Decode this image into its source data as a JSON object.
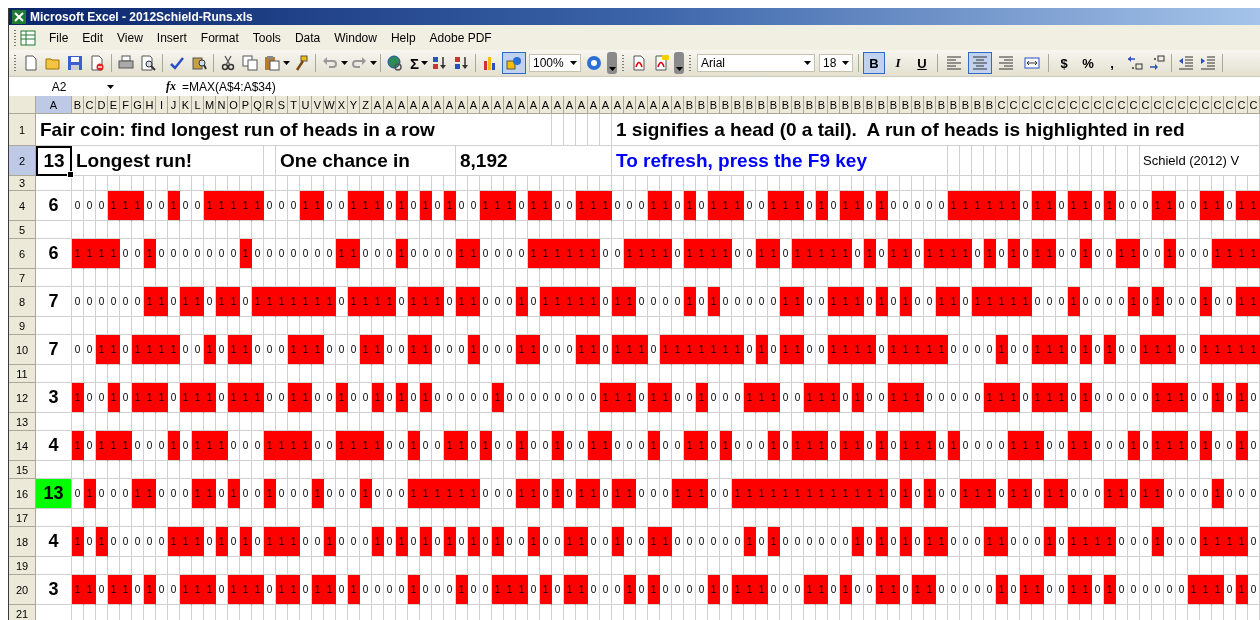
{
  "window": {
    "title": "Microsoft Excel - 2012Schield-Runs.xls"
  },
  "menu": [
    "File",
    "Edit",
    "View",
    "Insert",
    "Format",
    "Tools",
    "Data",
    "Window",
    "Help",
    "Adobe PDF"
  ],
  "toolbar": {
    "autosum": "Σ",
    "zoom": "100%",
    "drawing_pressed": true,
    "font": "Arial",
    "font_size": "18",
    "styles": [
      {
        "label": "B",
        "pressed": true
      },
      {
        "label": "I",
        "pressed": false
      },
      {
        "label": "U",
        "pressed": false
      }
    ],
    "alignment": [
      {
        "kind": "left",
        "pressed": false
      },
      {
        "kind": "center",
        "pressed": true
      },
      {
        "kind": "right",
        "pressed": false
      },
      {
        "kind": "merge",
        "pressed": false
      }
    ],
    "number_formats": [
      "$",
      "%",
      ","
    ]
  },
  "formula_bar": {
    "name_box": "A2",
    "fx": "fx",
    "formula": "=MAX(A$4:A$34)"
  },
  "sheet": {
    "column_a": {
      "label": "A",
      "selected": true
    },
    "column_headers": [
      "B",
      "C",
      "D",
      "E",
      "F",
      "G",
      "H",
      "I",
      "J",
      "K",
      "L",
      "M",
      "N",
      "O",
      "P",
      "Q",
      "R",
      "S",
      "T",
      "U",
      "V",
      "W",
      "X",
      "Y",
      "Z",
      "A",
      "A",
      "A",
      "A",
      "A",
      "A",
      "A",
      "A",
      "A",
      "A",
      "A",
      "A",
      "A",
      "A",
      "A",
      "A",
      "A",
      "A",
      "A",
      "A",
      "A",
      "A",
      "A",
      "A",
      "A",
      "A",
      "B",
      "B",
      "B",
      "B",
      "B",
      "B",
      "B",
      "B",
      "B",
      "B",
      "B",
      "B",
      "B",
      "B",
      "B",
      "B",
      "B",
      "B",
      "B",
      "B",
      "B",
      "B",
      "B",
      "B",
      "B",
      "B",
      "C",
      "C",
      "C",
      "C",
      "C",
      "C",
      "C",
      "C",
      "C",
      "C",
      "C",
      "C",
      "C",
      "C",
      "C",
      "C",
      "C",
      "C",
      "C",
      "C",
      "C",
      "C"
    ],
    "row_numbers": [
      {
        "label": "1",
        "selected": false
      },
      {
        "label": "2",
        "selected": true
      },
      {
        "label": "3",
        "selected": false
      },
      {
        "label": "4",
        "selected": false
      },
      {
        "label": "5",
        "selected": false
      },
      {
        "label": "6",
        "selected": false
      },
      {
        "label": "7",
        "selected": false
      },
      {
        "label": "8",
        "selected": false
      },
      {
        "label": "9",
        "selected": false
      },
      {
        "label": "10",
        "selected": false
      },
      {
        "label": "11",
        "selected": false
      },
      {
        "label": "12",
        "selected": false
      },
      {
        "label": "13",
        "selected": false
      },
      {
        "label": "14",
        "selected": false
      },
      {
        "label": "15",
        "selected": false
      },
      {
        "label": "16",
        "selected": false
      },
      {
        "label": "17",
        "selected": false
      },
      {
        "label": "18",
        "selected": false
      },
      {
        "label": "19",
        "selected": false
      },
      {
        "label": "20",
        "selected": false
      },
      {
        "label": "21",
        "selected": false
      }
    ],
    "title": "Fair coin: find longest run of heads in a row",
    "legend": "1 signifies a head (0 a tail).  A run of heads is highlighted in red",
    "active_cell": "13",
    "longest_label": "Longest run!",
    "chance_label": "One chance in",
    "chance_value": "8,192",
    "refresh_note": "To refresh, press the F9 key",
    "credit": "Schield (2012) V",
    "trials": [
      {
        "longest": "6",
        "max": false,
        "cells": [
          "0",
          "0",
          "0",
          "1",
          "1",
          "1",
          "0",
          "0",
          "1",
          "0",
          "0",
          "1",
          "1",
          "1",
          "1",
          "1",
          "0",
          "0",
          "0",
          "1",
          "1",
          "0",
          "0",
          "1",
          "1",
          "1",
          "0",
          "1",
          "0",
          "1",
          "0",
          "1",
          "0",
          "0",
          "1",
          "1",
          "1",
          "0",
          "1",
          "1",
          "0",
          "0",
          "1",
          "1",
          "1",
          "0",
          "0",
          "0",
          "1",
          "1",
          "0",
          "1",
          "0",
          "1",
          "1",
          "1",
          "0",
          "0",
          "1",
          "1",
          "1",
          "0",
          "1",
          "0",
          "1",
          "1",
          "0",
          "1",
          "0",
          "0",
          "0",
          "0",
          "0",
          "1",
          "1",
          "1",
          "1",
          "1",
          "1",
          "0",
          "1",
          "1",
          "0",
          "1",
          "1",
          "0",
          "1",
          "0",
          "0",
          "0",
          "1",
          "1",
          "0",
          "0",
          "1",
          "1",
          "0",
          "1",
          "1"
        ],
        "highlighted": [
          false,
          false,
          false,
          true,
          true,
          true,
          false,
          false,
          true,
          false,
          false,
          true,
          true,
          true,
          true,
          true,
          false,
          false,
          false,
          true,
          true,
          false,
          false,
          true,
          true,
          true,
          false,
          true,
          false,
          true,
          false,
          true,
          false,
          false,
          true,
          true,
          true,
          false,
          true,
          true,
          false,
          false,
          true,
          true,
          true,
          false,
          false,
          false,
          true,
          true,
          false,
          true,
          false,
          true,
          true,
          true,
          false,
          false,
          true,
          true,
          true,
          false,
          true,
          false,
          true,
          true,
          false,
          true,
          false,
          false,
          false,
          false,
          false,
          true,
          true,
          true,
          true,
          true,
          true,
          false,
          true,
          true,
          false,
          true,
          true,
          false,
          true,
          false,
          false,
          false,
          true,
          true,
          false,
          false,
          true,
          true,
          false,
          true,
          true
        ]
      },
      {
        "longest": "6",
        "max": false,
        "cells": [
          "1",
          "1",
          "1",
          "1",
          "0",
          "0",
          "1",
          "0",
          "0",
          "0",
          "0",
          "0",
          "0",
          "0",
          "1",
          "0",
          "0",
          "0",
          "0",
          "0",
          "0",
          "0",
          "1",
          "1",
          "0",
          "0",
          "0",
          "1",
          "0",
          "0",
          "0",
          "0",
          "1",
          "1",
          "0",
          "0",
          "0",
          "0",
          "1",
          "1",
          "1",
          "1",
          "1",
          "1",
          "0",
          "0",
          "1",
          "1",
          "1",
          "1",
          "0",
          "1",
          "1",
          "1",
          "1",
          "0",
          "0",
          "1",
          "1",
          "0",
          "1",
          "1",
          "1",
          "1",
          "1",
          "0",
          "1",
          "0",
          "1",
          "1",
          "0",
          "1",
          "1",
          "1",
          "1",
          "0",
          "1",
          "0",
          "1",
          "0",
          "1",
          "1",
          "0",
          "0",
          "1",
          "0",
          "0",
          "1",
          "1",
          "0",
          "0",
          "1",
          "0",
          "0",
          "0",
          "1",
          "1",
          "1",
          "1"
        ],
        "highlighted": [
          true,
          true,
          true,
          true,
          false,
          false,
          true,
          false,
          false,
          false,
          false,
          false,
          false,
          false,
          true,
          false,
          false,
          false,
          false,
          false,
          false,
          false,
          true,
          true,
          false,
          false,
          false,
          true,
          false,
          false,
          false,
          false,
          true,
          true,
          false,
          false,
          false,
          false,
          true,
          true,
          true,
          true,
          true,
          true,
          false,
          false,
          true,
          true,
          true,
          true,
          false,
          true,
          true,
          true,
          true,
          false,
          false,
          true,
          true,
          false,
          true,
          true,
          true,
          true,
          true,
          false,
          true,
          false,
          true,
          true,
          false,
          true,
          true,
          true,
          true,
          false,
          true,
          false,
          true,
          false,
          true,
          true,
          false,
          false,
          true,
          false,
          false,
          true,
          true,
          false,
          false,
          true,
          false,
          false,
          false,
          true,
          true,
          true,
          true
        ]
      },
      {
        "longest": "7",
        "max": false,
        "cells": [
          "0",
          "0",
          "0",
          "0",
          "0",
          "0",
          "1",
          "1",
          "0",
          "1",
          "1",
          "0",
          "1",
          "1",
          "0",
          "1",
          "1",
          "1",
          "1",
          "1",
          "1",
          "1",
          "0",
          "1",
          "1",
          "1",
          "1",
          "0",
          "1",
          "1",
          "1",
          "0",
          "1",
          "1",
          "0",
          "0",
          "0",
          "1",
          "0",
          "1",
          "1",
          "1",
          "1",
          "1",
          "0",
          "1",
          "1",
          "0",
          "0",
          "0",
          "0",
          "1",
          "0",
          "1",
          "0",
          "0",
          "0",
          "0",
          "0",
          "1",
          "1",
          "0",
          "0",
          "1",
          "1",
          "1",
          "0",
          "1",
          "0",
          "1",
          "0",
          "0",
          "1",
          "1",
          "0",
          "1",
          "1",
          "1",
          "1",
          "1",
          "0",
          "0",
          "0",
          "1",
          "0",
          "0",
          "0",
          "0",
          "1",
          "0",
          "1",
          "0",
          "0",
          "0",
          "1",
          "0",
          "0",
          "1",
          "1"
        ],
        "highlighted": [
          false,
          false,
          false,
          false,
          false,
          false,
          true,
          true,
          false,
          true,
          true,
          false,
          true,
          true,
          false,
          true,
          true,
          true,
          true,
          true,
          true,
          true,
          false,
          true,
          true,
          true,
          true,
          false,
          true,
          true,
          true,
          false,
          true,
          true,
          false,
          false,
          false,
          true,
          false,
          true,
          true,
          true,
          true,
          true,
          false,
          true,
          true,
          false,
          false,
          false,
          false,
          true,
          false,
          true,
          false,
          false,
          false,
          false,
          false,
          true,
          true,
          false,
          false,
          true,
          true,
          true,
          false,
          true,
          false,
          true,
          false,
          false,
          true,
          true,
          false,
          true,
          true,
          true,
          true,
          true,
          false,
          false,
          false,
          true,
          false,
          false,
          false,
          false,
          true,
          false,
          true,
          false,
          false,
          false,
          true,
          false,
          false,
          true,
          true
        ]
      },
      {
        "longest": "7",
        "max": false,
        "cells": [
          "0",
          "0",
          "1",
          "1",
          "0",
          "1",
          "1",
          "1",
          "1",
          "0",
          "0",
          "1",
          "0",
          "1",
          "1",
          "0",
          "0",
          "0",
          "1",
          "1",
          "1",
          "0",
          "0",
          "0",
          "1",
          "1",
          "0",
          "0",
          "1",
          "1",
          "0",
          "0",
          "0",
          "1",
          "0",
          "0",
          "0",
          "1",
          "1",
          "0",
          "0",
          "0",
          "1",
          "1",
          "0",
          "1",
          "1",
          "1",
          "0",
          "1",
          "1",
          "1",
          "1",
          "1",
          "1",
          "1",
          "0",
          "1",
          "0",
          "1",
          "1",
          "0",
          "0",
          "1",
          "1",
          "1",
          "1",
          "0",
          "1",
          "1",
          "1",
          "1",
          "1",
          "0",
          "0",
          "0",
          "0",
          "1",
          "0",
          "0",
          "1",
          "1",
          "1",
          "0",
          "1",
          "0",
          "1",
          "0",
          "0",
          "1",
          "1",
          "1",
          "0",
          "0",
          "1",
          "1",
          "1",
          "1",
          "1"
        ],
        "highlighted": [
          false,
          false,
          true,
          true,
          false,
          true,
          true,
          true,
          true,
          false,
          false,
          true,
          false,
          true,
          true,
          false,
          false,
          false,
          true,
          true,
          true,
          false,
          false,
          false,
          true,
          true,
          false,
          false,
          true,
          true,
          false,
          false,
          false,
          true,
          false,
          false,
          false,
          true,
          true,
          false,
          false,
          false,
          true,
          true,
          false,
          true,
          true,
          true,
          false,
          true,
          true,
          true,
          true,
          true,
          true,
          true,
          false,
          true,
          false,
          true,
          true,
          false,
          false,
          true,
          true,
          true,
          true,
          false,
          true,
          true,
          true,
          true,
          true,
          false,
          false,
          false,
          false,
          true,
          false,
          false,
          true,
          true,
          true,
          false,
          true,
          false,
          true,
          false,
          false,
          true,
          true,
          true,
          false,
          false,
          true,
          true,
          true,
          true,
          true
        ]
      },
      {
        "longest": "3",
        "max": false,
        "cells": [
          "1",
          "0",
          "0",
          "1",
          "0",
          "1",
          "1",
          "1",
          "0",
          "1",
          "1",
          "1",
          "0",
          "1",
          "1",
          "1",
          "0",
          "0",
          "1",
          "1",
          "0",
          "0",
          "1",
          "0",
          "0",
          "1",
          "0",
          "1",
          "0",
          "1",
          "0",
          "0",
          "0",
          "0",
          "0",
          "1",
          "0",
          "0",
          "0",
          "0",
          "0",
          "0",
          "0",
          "0",
          "1",
          "1",
          "1",
          "0",
          "1",
          "1",
          "0",
          "0",
          "1",
          "0",
          "0",
          "0",
          "1",
          "1",
          "1",
          "0",
          "0",
          "1",
          "1",
          "1",
          "0",
          "1",
          "0",
          "0",
          "1",
          "1",
          "1",
          "0",
          "0",
          "0",
          "0",
          "0",
          "1",
          "1",
          "1",
          "0",
          "1",
          "1",
          "1",
          "0",
          "1",
          "0",
          "0",
          "0",
          "0",
          "0",
          "1",
          "1",
          "1",
          "0",
          "0",
          "1",
          "0",
          "1",
          "0"
        ],
        "highlighted": [
          true,
          false,
          false,
          true,
          false,
          true,
          true,
          true,
          false,
          true,
          true,
          true,
          false,
          true,
          true,
          true,
          false,
          false,
          true,
          true,
          false,
          false,
          true,
          false,
          false,
          true,
          false,
          true,
          false,
          true,
          false,
          false,
          false,
          false,
          false,
          true,
          false,
          false,
          false,
          false,
          false,
          false,
          false,
          false,
          true,
          true,
          true,
          false,
          true,
          true,
          false,
          false,
          true,
          false,
          false,
          false,
          true,
          true,
          true,
          false,
          false,
          true,
          true,
          true,
          false,
          true,
          false,
          false,
          true,
          true,
          true,
          false,
          false,
          false,
          false,
          false,
          true,
          true,
          true,
          false,
          true,
          true,
          true,
          false,
          true,
          false,
          false,
          false,
          false,
          false,
          true,
          true,
          true,
          false,
          false,
          true,
          false,
          true,
          false
        ]
      },
      {
        "longest": "4",
        "max": false,
        "cells": [
          "1",
          "0",
          "1",
          "1",
          "1",
          "0",
          "0",
          "0",
          "1",
          "0",
          "1",
          "1",
          "1",
          "0",
          "0",
          "0",
          "1",
          "1",
          "1",
          "1",
          "0",
          "0",
          "1",
          "1",
          "1",
          "1",
          "0",
          "0",
          "1",
          "0",
          "0",
          "1",
          "1",
          "0",
          "1",
          "0",
          "0",
          "1",
          "0",
          "0",
          "1",
          "0",
          "0",
          "1",
          "1",
          "0",
          "0",
          "0",
          "1",
          "0",
          "0",
          "1",
          "1",
          "0",
          "1",
          "0",
          "0",
          "0",
          "1",
          "0",
          "1",
          "1",
          "1",
          "0",
          "1",
          "1",
          "0",
          "1",
          "0",
          "1",
          "1",
          "1",
          "0",
          "1",
          "0",
          "0",
          "0",
          "0",
          "1",
          "1",
          "1",
          "0",
          "0",
          "1",
          "1",
          "0",
          "0",
          "0",
          "1",
          "0",
          "1",
          "1",
          "1",
          "0",
          "1",
          "0",
          "0",
          "1",
          "0"
        ],
        "highlighted": [
          true,
          false,
          true,
          true,
          true,
          false,
          false,
          false,
          true,
          false,
          true,
          true,
          true,
          false,
          false,
          false,
          true,
          true,
          true,
          true,
          false,
          false,
          true,
          true,
          true,
          true,
          false,
          false,
          true,
          false,
          false,
          true,
          true,
          false,
          true,
          false,
          false,
          true,
          false,
          false,
          true,
          false,
          false,
          true,
          true,
          false,
          false,
          false,
          true,
          false,
          false,
          true,
          true,
          false,
          true,
          false,
          false,
          false,
          true,
          false,
          true,
          true,
          true,
          false,
          true,
          true,
          false,
          true,
          false,
          true,
          true,
          true,
          false,
          true,
          false,
          false,
          false,
          false,
          true,
          true,
          true,
          false,
          false,
          true,
          true,
          false,
          false,
          false,
          true,
          false,
          true,
          true,
          true,
          false,
          true,
          false,
          false,
          true,
          false
        ]
      },
      {
        "longest": "13",
        "max": true,
        "cells": [
          "0",
          "1",
          "0",
          "0",
          "0",
          "1",
          "1",
          "0",
          "0",
          "0",
          "1",
          "1",
          "0",
          "1",
          "0",
          "0",
          "1",
          "0",
          "0",
          "0",
          "1",
          "0",
          "0",
          "0",
          "1",
          "0",
          "0",
          "0",
          "1",
          "1",
          "1",
          "1",
          "1",
          "1",
          "0",
          "0",
          "0",
          "1",
          "1",
          "0",
          "1",
          "0",
          "1",
          "1",
          "0",
          "1",
          "1",
          "0",
          "0",
          "0",
          "1",
          "1",
          "1",
          "0",
          "0",
          "1",
          "1",
          "1",
          "1",
          "1",
          "1",
          "1",
          "1",
          "1",
          "1",
          "1",
          "1",
          "1",
          "0",
          "1",
          "0",
          "1",
          "0",
          "0",
          "1",
          "1",
          "1",
          "0",
          "1",
          "1",
          "0",
          "1",
          "1",
          "0",
          "0",
          "0",
          "1",
          "1",
          "0",
          "1",
          "1",
          "0",
          "0",
          "0",
          "0",
          "1",
          "0",
          "0",
          "0"
        ],
        "highlighted": [
          false,
          true,
          false,
          false,
          false,
          true,
          true,
          false,
          false,
          false,
          true,
          true,
          false,
          true,
          false,
          false,
          true,
          false,
          false,
          false,
          true,
          false,
          false,
          false,
          true,
          false,
          false,
          false,
          true,
          true,
          true,
          true,
          true,
          true,
          false,
          false,
          false,
          true,
          true,
          false,
          true,
          false,
          true,
          true,
          false,
          true,
          true,
          false,
          false,
          false,
          true,
          true,
          true,
          false,
          false,
          true,
          true,
          true,
          true,
          true,
          true,
          true,
          true,
          true,
          true,
          true,
          true,
          true,
          false,
          true,
          false,
          true,
          false,
          false,
          true,
          true,
          true,
          false,
          true,
          true,
          false,
          true,
          true,
          false,
          false,
          false,
          true,
          true,
          false,
          true,
          true,
          false,
          false,
          false,
          false,
          true,
          false,
          false,
          false
        ]
      },
      {
        "longest": "4",
        "max": false,
        "cells": [
          "1",
          "0",
          "1",
          "0",
          "0",
          "0",
          "0",
          "0",
          "1",
          "1",
          "1",
          "0",
          "1",
          "0",
          "1",
          "0",
          "1",
          "1",
          "1",
          "0",
          "0",
          "1",
          "0",
          "0",
          "0",
          "1",
          "0",
          "1",
          "0",
          "1",
          "0",
          "1",
          "0",
          "1",
          "0",
          "1",
          "0",
          "0",
          "1",
          "0",
          "0",
          "1",
          "1",
          "0",
          "0",
          "1",
          "0",
          "0",
          "1",
          "1",
          "0",
          "0",
          "0",
          "0",
          "0",
          "0",
          "1",
          "0",
          "1",
          "0",
          "0",
          "0",
          "0",
          "0",
          "0",
          "1",
          "0",
          "1",
          "0",
          "1",
          "0",
          "1",
          "1",
          "0",
          "0",
          "0",
          "1",
          "1",
          "0",
          "0",
          "0",
          "1",
          "0",
          "1",
          "1",
          "1",
          "1",
          "0",
          "0",
          "0",
          "1",
          "0",
          "0",
          "0",
          "1",
          "1",
          "1",
          "1",
          "0"
        ],
        "highlighted": [
          true,
          false,
          true,
          false,
          false,
          false,
          false,
          false,
          true,
          true,
          true,
          false,
          true,
          false,
          true,
          false,
          true,
          true,
          true,
          false,
          false,
          true,
          false,
          false,
          false,
          true,
          false,
          true,
          false,
          true,
          false,
          true,
          false,
          true,
          false,
          true,
          false,
          false,
          true,
          false,
          false,
          true,
          true,
          false,
          false,
          true,
          false,
          false,
          true,
          true,
          false,
          false,
          false,
          false,
          false,
          false,
          true,
          false,
          true,
          false,
          false,
          false,
          false,
          false,
          false,
          true,
          false,
          true,
          false,
          true,
          false,
          true,
          true,
          false,
          false,
          false,
          true,
          true,
          false,
          false,
          false,
          true,
          false,
          true,
          true,
          true,
          true,
          false,
          false,
          false,
          true,
          false,
          false,
          false,
          true,
          true,
          true,
          true,
          false
        ]
      },
      {
        "longest": "3",
        "max": false,
        "cells": [
          "1",
          "1",
          "0",
          "1",
          "1",
          "0",
          "1",
          "0",
          "0",
          "1",
          "1",
          "1",
          "0",
          "1",
          "1",
          "1",
          "0",
          "1",
          "1",
          "0",
          "1",
          "1",
          "0",
          "1",
          "0",
          "0",
          "0",
          "0",
          "1",
          "0",
          "0",
          "0",
          "1",
          "0",
          "0",
          "1",
          "1",
          "1",
          "0",
          "1",
          "0",
          "1",
          "1",
          "0",
          "0",
          "0",
          "1",
          "0",
          "1",
          "0",
          "0",
          "0",
          "0",
          "1",
          "0",
          "1",
          "1",
          "1",
          "0",
          "0",
          "0",
          "1",
          "1",
          "0",
          "1",
          "0",
          "0",
          "1",
          "1",
          "0",
          "1",
          "1",
          "0",
          "0",
          "0",
          "0",
          "0",
          "1",
          "0",
          "1",
          "1",
          "0",
          "0",
          "1",
          "1",
          "0",
          "1",
          "0",
          "0",
          "0",
          "0",
          "0",
          "0",
          "1",
          "1",
          "1",
          "0",
          "1",
          "0"
        ],
        "highlighted": [
          true,
          true,
          false,
          true,
          true,
          false,
          true,
          false,
          false,
          true,
          true,
          true,
          false,
          true,
          true,
          true,
          false,
          true,
          true,
          false,
          true,
          true,
          false,
          true,
          false,
          false,
          false,
          false,
          true,
          false,
          false,
          false,
          true,
          false,
          false,
          true,
          true,
          true,
          false,
          true,
          false,
          true,
          true,
          false,
          false,
          false,
          true,
          false,
          true,
          false,
          false,
          false,
          false,
          true,
          false,
          true,
          true,
          true,
          false,
          false,
          false,
          true,
          true,
          false,
          true,
          false,
          false,
          true,
          true,
          false,
          true,
          true,
          false,
          false,
          false,
          false,
          false,
          true,
          false,
          true,
          true,
          false,
          false,
          true,
          true,
          false,
          true,
          false,
          false,
          false,
          false,
          false,
          false,
          true,
          true,
          true,
          false,
          true,
          false
        ]
      }
    ]
  }
}
